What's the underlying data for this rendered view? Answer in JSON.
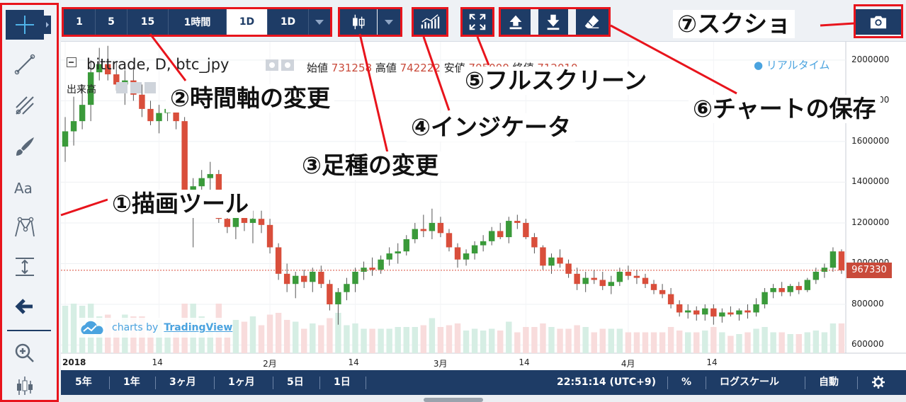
{
  "toolbar": {
    "intervals": [
      "1",
      "5",
      "15",
      "1時間",
      "1D",
      "1D"
    ],
    "active_interval_index": 4
  },
  "legend": {
    "title": "bittrade, D, btc_jpy",
    "open_label": "始値",
    "open_value": "731258",
    "high_label": "高値",
    "high_value": "742222",
    "low_label": "安値",
    "low_value": "705000",
    "close_label": "終値",
    "close_value": "712010",
    "volume_label": "出来高",
    "realtime_label": "リアルタイム"
  },
  "watermark": {
    "prefix": "charts by",
    "brand": "TradingView"
  },
  "annotations": {
    "drawing_tools": "①描画ツール",
    "time_axis": "②時間軸の変更",
    "candle_type": "③足種の変更",
    "indicator": "④インジケータ",
    "fullscreen": "⑤フルスクリーン",
    "save_chart": "⑥チャートの保存",
    "screenshot": "⑦スクショ"
  },
  "bottombar": {
    "ranges": [
      "5年",
      "1年",
      "3ヶ月",
      "1ヶ月",
      "5日",
      "1日"
    ],
    "time": "22:51:14 (UTC+9)",
    "percent": "%",
    "log_scale": "ログスケール",
    "auto": "自動"
  },
  "colors": {
    "navy": "#1e3c66",
    "annotation_red": "#e8141c",
    "up_candle": "#3a9a3a",
    "down_candle": "#d94e3b",
    "price_tag": "#c94a3a"
  },
  "icons": {
    "tools": [
      "crosshair-icon",
      "trend-line-icon",
      "pitchfork-icon",
      "brush-icon",
      "text-icon",
      "pattern-icon",
      "measure-icon",
      "arrow-left-icon",
      "zoom-in-icon",
      "candles-icon"
    ],
    "toolbar": [
      "candle-style-icon",
      "indicator-icon",
      "fullscreen-icon",
      "upload-icon",
      "download-icon",
      "eraser-icon",
      "camera-icon",
      "gear-icon"
    ]
  },
  "chart_data": {
    "type": "candlestick",
    "current_price": "967330",
    "y_axis_ticks": [
      "2000000",
      "1800000",
      "1600000",
      "1400000",
      "1200000",
      "1000000",
      "800000",
      "600000"
    ],
    "x_axis_ticks": [
      "2018",
      "14",
      "2月",
      "14",
      "3月",
      "14",
      "4月",
      "14"
    ],
    "ylim": [
      560000,
      2090000
    ],
    "candles": [
      [
        1575000,
        1720000,
        1500000,
        1650000
      ],
      [
        1650000,
        1820000,
        1580000,
        1700000
      ],
      [
        1700000,
        1880000,
        1660000,
        1780000
      ],
      [
        1780000,
        2000000,
        1700000,
        1940000
      ],
      [
        1940000,
        2060000,
        1900000,
        1980000
      ],
      [
        1980000,
        2070000,
        1900000,
        1930000
      ],
      [
        1930000,
        1990000,
        1850000,
        1880000
      ],
      [
        1880000,
        1950000,
        1780000,
        1900000
      ],
      [
        1900000,
        1960000,
        1800000,
        1830000
      ],
      [
        1830000,
        1880000,
        1720000,
        1760000
      ],
      [
        1760000,
        1800000,
        1680000,
        1700000
      ],
      [
        1700000,
        1780000,
        1640000,
        1740000
      ],
      [
        1740000,
        1800000,
        1700000,
        1760000
      ],
      [
        1760000,
        1780000,
        1660000,
        1700000
      ],
      [
        1700000,
        1720000,
        1240000,
        1300000
      ],
      [
        1300000,
        1420000,
        1080000,
        1380000
      ],
      [
        1380000,
        1460000,
        1300000,
        1420000
      ],
      [
        1420000,
        1500000,
        1360000,
        1440000
      ],
      [
        1440000,
        1460000,
        1200000,
        1220000
      ],
      [
        1220000,
        1260000,
        1150000,
        1180000
      ],
      [
        1180000,
        1260000,
        1120000,
        1240000
      ],
      [
        1240000,
        1290000,
        1160000,
        1200000
      ],
      [
        1200000,
        1260000,
        1100000,
        1220000
      ],
      [
        1220000,
        1260000,
        1150000,
        1190000
      ],
      [
        1190000,
        1220000,
        1050000,
        1080000
      ],
      [
        1080000,
        1100000,
        920000,
        950000
      ],
      [
        950000,
        1000000,
        860000,
        900000
      ],
      [
        900000,
        960000,
        830000,
        940000
      ],
      [
        940000,
        970000,
        880000,
        910000
      ],
      [
        910000,
        980000,
        860000,
        960000
      ],
      [
        960000,
        990000,
        880000,
        900000
      ],
      [
        900000,
        920000,
        770000,
        800000
      ],
      [
        800000,
        880000,
        700000,
        860000
      ],
      [
        860000,
        930000,
        820000,
        900000
      ],
      [
        900000,
        980000,
        860000,
        960000
      ],
      [
        960000,
        1010000,
        920000,
        980000
      ],
      [
        980000,
        1030000,
        940000,
        970000
      ],
      [
        970000,
        1040000,
        950000,
        1020000
      ],
      [
        1020000,
        1080000,
        990000,
        1050000
      ],
      [
        1050000,
        1100000,
        1000000,
        1060000
      ],
      [
        1060000,
        1140000,
        1040000,
        1120000
      ],
      [
        1120000,
        1200000,
        1100000,
        1170000
      ],
      [
        1170000,
        1240000,
        1130000,
        1160000
      ],
      [
        1160000,
        1270000,
        1120000,
        1200000
      ],
      [
        1200000,
        1230000,
        1130000,
        1150000
      ],
      [
        1150000,
        1170000,
        1060000,
        1080000
      ],
      [
        1080000,
        1100000,
        980000,
        1020000
      ],
      [
        1020000,
        1070000,
        990000,
        1050000
      ],
      [
        1050000,
        1110000,
        1020000,
        1090000
      ],
      [
        1090000,
        1140000,
        1060000,
        1110000
      ],
      [
        1110000,
        1180000,
        1090000,
        1160000
      ],
      [
        1160000,
        1200000,
        1120000,
        1130000
      ],
      [
        1130000,
        1230000,
        1100000,
        1210000
      ],
      [
        1210000,
        1240000,
        1170000,
        1200000
      ],
      [
        1200000,
        1220000,
        1120000,
        1130000
      ],
      [
        1130000,
        1150000,
        1050000,
        1080000
      ],
      [
        1080000,
        1090000,
        970000,
        990000
      ],
      [
        990000,
        1050000,
        950000,
        1030000
      ],
      [
        1030000,
        1070000,
        980000,
        1000000
      ],
      [
        1000000,
        1020000,
        930000,
        950000
      ],
      [
        950000,
        980000,
        870000,
        900000
      ],
      [
        900000,
        960000,
        860000,
        930000
      ],
      [
        930000,
        970000,
        900000,
        920000
      ],
      [
        920000,
        960000,
        870000,
        890000
      ],
      [
        890000,
        940000,
        850000,
        910000
      ],
      [
        910000,
        980000,
        890000,
        960000
      ],
      [
        960000,
        990000,
        920000,
        940000
      ],
      [
        940000,
        970000,
        900000,
        930000
      ],
      [
        930000,
        950000,
        880000,
        900000
      ],
      [
        900000,
        920000,
        850000,
        870000
      ],
      [
        870000,
        900000,
        830000,
        850000
      ],
      [
        850000,
        880000,
        780000,
        800000
      ],
      [
        800000,
        820000,
        740000,
        760000
      ],
      [
        760000,
        800000,
        730000,
        770000
      ],
      [
        770000,
        790000,
        720000,
        750000
      ],
      [
        750000,
        800000,
        720000,
        780000
      ],
      [
        780000,
        800000,
        700000,
        740000
      ],
      [
        740000,
        780000,
        710000,
        760000
      ],
      [
        760000,
        790000,
        740000,
        750000
      ],
      [
        750000,
        780000,
        720000,
        770000
      ],
      [
        770000,
        800000,
        730000,
        760000
      ],
      [
        760000,
        830000,
        740000,
        800000
      ],
      [
        800000,
        880000,
        780000,
        860000
      ],
      [
        860000,
        900000,
        830000,
        880000
      ],
      [
        880000,
        910000,
        840000,
        860000
      ],
      [
        860000,
        900000,
        840000,
        890000
      ],
      [
        890000,
        910000,
        850000,
        870000
      ],
      [
        870000,
        930000,
        860000,
        920000
      ],
      [
        920000,
        980000,
        900000,
        960000
      ],
      [
        960000,
        1000000,
        930000,
        980000
      ],
      [
        980000,
        1080000,
        960000,
        1060000
      ],
      [
        1060000,
        1070000,
        950000,
        967330
      ]
    ]
  }
}
